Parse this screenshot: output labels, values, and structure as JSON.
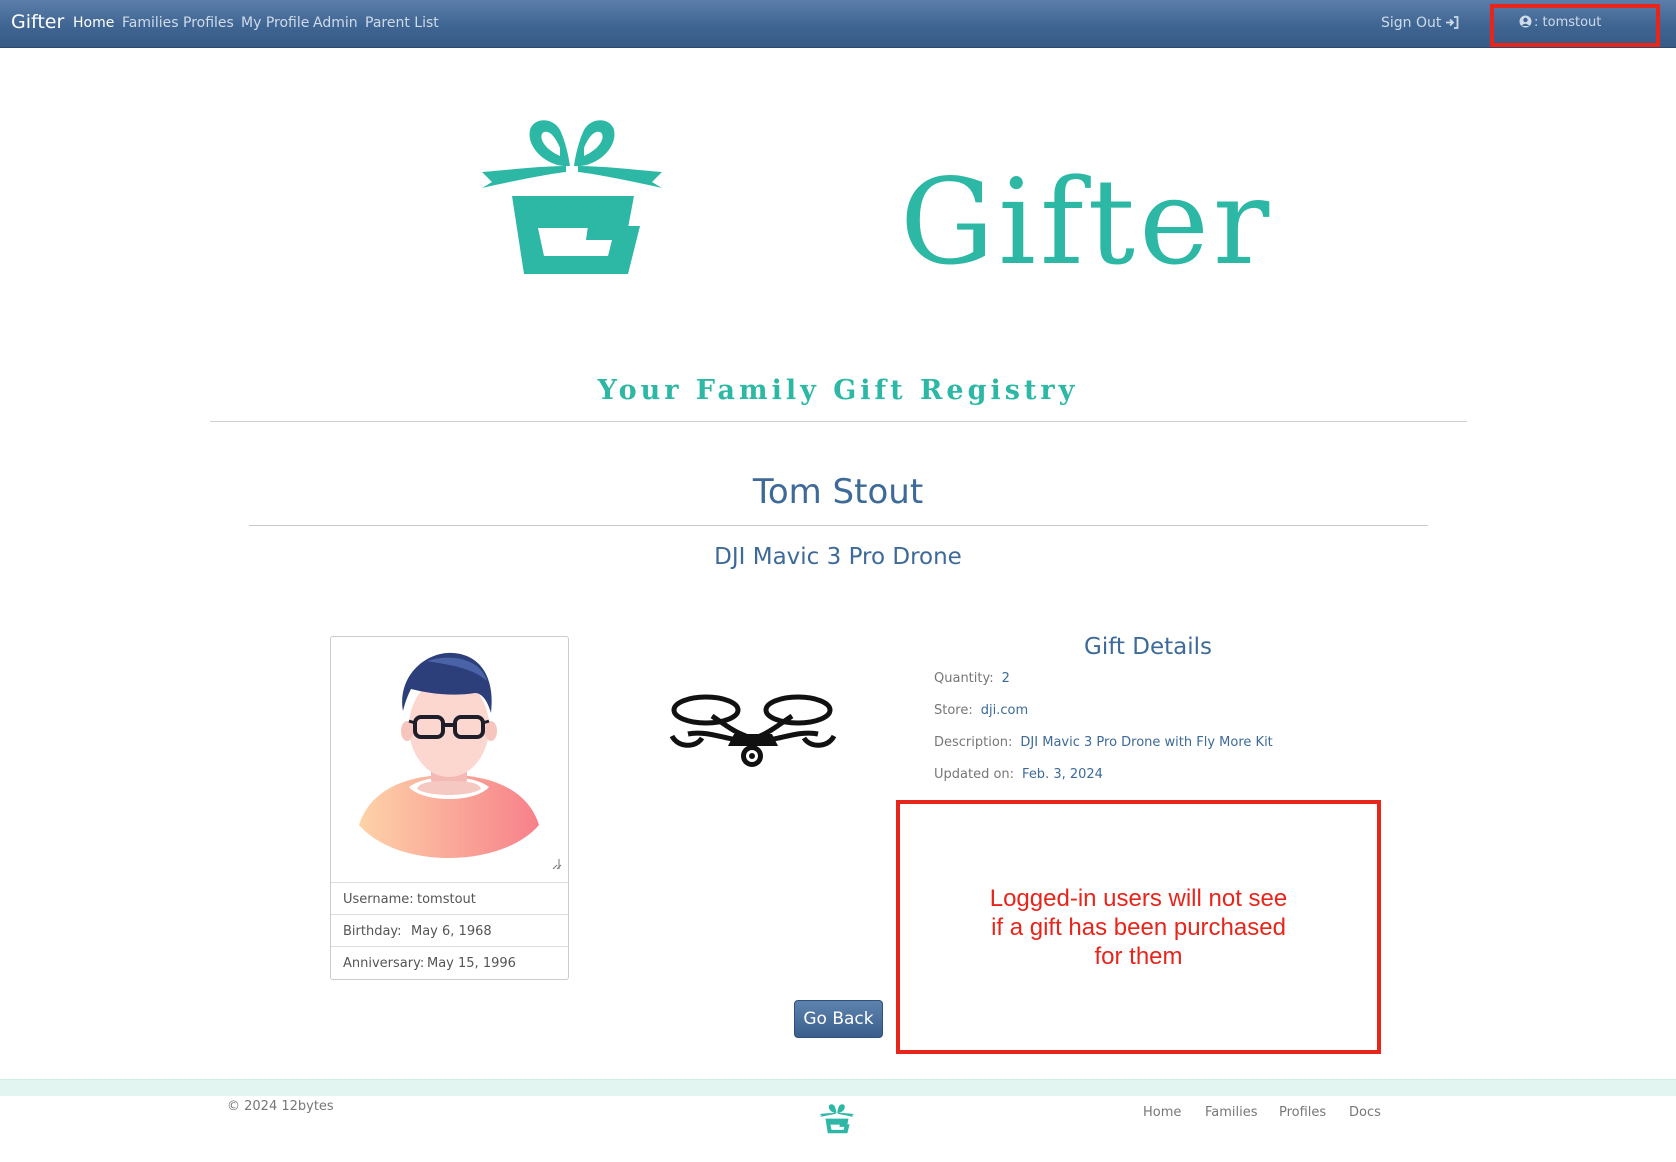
{
  "navbar": {
    "brand": "Gifter",
    "links": [
      "Home",
      "Families",
      "Profiles",
      "My Profile",
      "Admin",
      "Parent List"
    ],
    "sign_out": "Sign Out",
    "user": ": tomstout"
  },
  "hero": {
    "logo_word": "Gifter",
    "tagline": "Your Family Gift Registry"
  },
  "profile": {
    "name": "Tom Stout",
    "username_label": "Username:",
    "username": "tomstout",
    "birthday_label": "Birthday:",
    "birthday": "May 6, 1968",
    "anniversary_label": "Anniversary:",
    "anniversary": "May 15, 1996"
  },
  "gift": {
    "title": "DJI Mavic 3 Pro Drone",
    "details_heading": "Gift Details",
    "quantity_label": "Quantity:",
    "quantity": "2",
    "store_label": "Store:",
    "store": "dji.com",
    "description_label": "Description:",
    "description": "DJI Mavic 3 Pro Drone with Fly More Kit",
    "updated_label": "Updated on:",
    "updated": "Feb. 3, 2024"
  },
  "annotation": {
    "line1": "Logged-in users will not see",
    "line2": "if a gift has been purchased",
    "line3": "for them"
  },
  "actions": {
    "go_back": "Go Back"
  },
  "footer": {
    "copyright": "© 2024 12bytes",
    "links": [
      "Home",
      "Families",
      "Profiles",
      "Docs"
    ]
  },
  "colors": {
    "navbar": "#3f6592",
    "brand_teal": "#2db8a6",
    "heading_blue": "#3d6a98",
    "annotation_red": "#e8251b"
  }
}
